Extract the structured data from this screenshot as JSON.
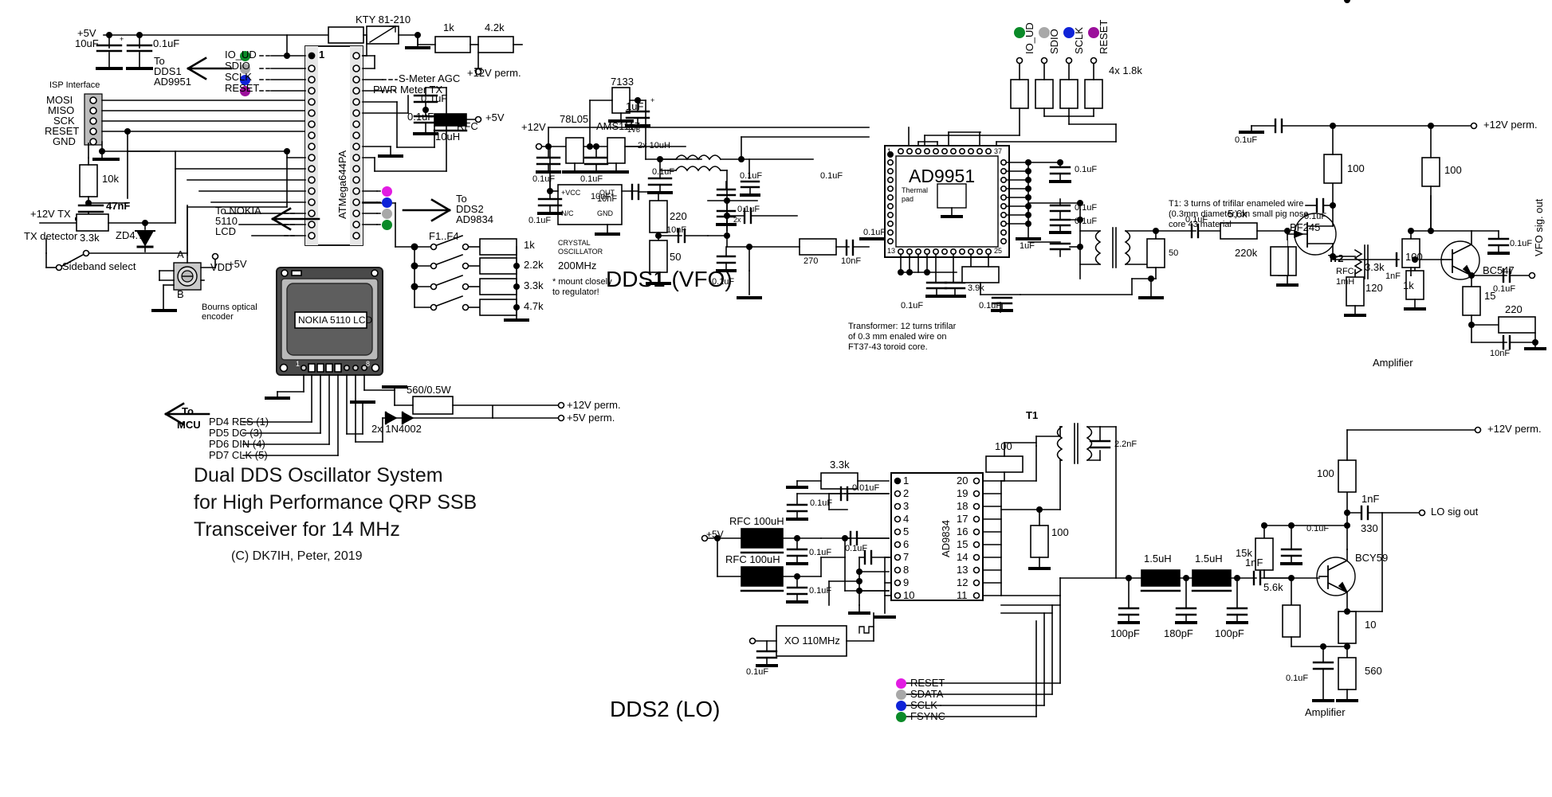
{
  "document": {
    "type": "schematic",
    "title_lines": [
      "Dual DDS Oscillator System",
      "for High Performance QRP SSB",
      "Transceiver for 14 MHz"
    ],
    "copyright": "(C) DK7IH, Peter, 2019",
    "section_dds1": "DDS1 (VFO)",
    "section_dds2": "DDS2 (LO)"
  },
  "mcu": {
    "chip": "ATMega644PA",
    "pin1": "1",
    "isp_header_title": "ISP Interface",
    "isp_pins": [
      "MOSI",
      "MISO",
      "SCK",
      "RESET",
      "GND"
    ],
    "bus_labels": [
      "IO_UD",
      "SDIO",
      "SCLK",
      "RESET"
    ],
    "bus_colors": [
      "#0a8a28",
      "#a8a8a8",
      "#0f23d8",
      "#9b0f9b"
    ],
    "to_dds1": [
      "To",
      "DDS1",
      "AD9951"
    ],
    "to_dds2": [
      "To",
      "DDS2",
      "AD9834"
    ],
    "to_lcd": [
      "To NOKIA",
      "5110",
      "LCD"
    ],
    "to_mcu": [
      "To",
      "MCU"
    ],
    "dds2_dot_colors": [
      "#e21ce2",
      "#0f23d8",
      "#a8a8a8",
      "#0a8a28"
    ],
    "signals": [
      "S-Meter AGC",
      "PWR Meter TX"
    ],
    "sensor": "KTY 81-210",
    "rails": {
      "p5v_a": "+5V",
      "p5v_b": "+5V",
      "p12v_perm": "+12V perm.",
      "p12v_tx": "+12V TX",
      "vdd": "VDD",
      "vdd_rail": "+5V"
    },
    "caps": [
      "10uF",
      "0.1uF",
      "0.1uF",
      "0.1uF",
      "47nF"
    ],
    "res": [
      "1k",
      "4.2k",
      "10k",
      "3.3k"
    ],
    "rfc": "RFC",
    "rfc_val": "10uH",
    "zener": "ZD4.7",
    "tx_detector": "TX detector",
    "sideband_select": "Sideband select",
    "encoder": {
      "a": "A",
      "b": "B",
      "name_lines": [
        "Bourns optical",
        "encoder"
      ]
    },
    "fkeys": {
      "label": "F1..F4",
      "resistors": [
        "1k",
        "2.2k",
        "3.3k",
        "4.7k"
      ]
    }
  },
  "lcd": {
    "screen_text": "NOKIA 5110 LCD",
    "pin_first": "1",
    "pin_last": "8",
    "mcu_pins": [
      "PD4 RES (1)",
      "PD5 DC (3)",
      "PD6 DIN (4)",
      "PD7 CLK (5)"
    ],
    "diodes": "2x 1N4002",
    "resistor": "560/0.5W",
    "rail_12v": "+12V perm.",
    "rail_5v": "+5V perm."
  },
  "dds1": {
    "chip": "AD9951",
    "thermal_pad": [
      "Thermal",
      "pad"
    ],
    "pin_numbers": [
      "1",
      "37",
      "13",
      "25"
    ],
    "bus_labels": [
      "IO_UD",
      "SDIO",
      "SCLK",
      "RESET"
    ],
    "bus_colors": [
      "#0a8a28",
      "#a8a8a8",
      "#0f23d8",
      "#9b0f9b"
    ],
    "bus_res": "4x 1.8k",
    "regs": [
      "78L05",
      "AMS1117",
      "7133"
    ],
    "reg_out": "1V8",
    "rail_in": "+12V",
    "chokes": "2x 10uH",
    "xo": {
      "title_lines": [
        "CRYSTAL",
        "OSCILLATOR"
      ],
      "freq": "200MHz",
      "pins": [
        "+VCC",
        "OUT",
        "N/C",
        "GND"
      ]
    },
    "note_mount": [
      "* mount closely",
      "to regulator!"
    ],
    "caps": [
      "0.1uF",
      "0.1uF",
      "0.1uF",
      "1uF",
      "10uF*",
      "10nF",
      "10nF",
      "0.1uF",
      "0.1uF",
      "0.1uF",
      "0.1uF",
      "0.1uF",
      "0.1uF",
      "0.1uF",
      "0.1uF",
      "0.1uF",
      "1uF",
      "10nF",
      "0.1uF"
    ],
    "res": [
      "220",
      "50",
      "270",
      "3.9k",
      "50"
    ],
    "t1_note": [
      "T1: 3 turns of trifilar enameled wire",
      "(0.3mm diameter) on small pig nose",
      "core 43 material"
    ]
  },
  "vfo_amp": {
    "title": "Amplifier",
    "jfet": "BF245",
    "jfet_ref": "Tr2",
    "bjt": "BC547",
    "rfc": [
      "RFC",
      "1mH"
    ],
    "res": [
      "5.6k",
      "220k",
      "120",
      "100",
      "100",
      "3.3k",
      "100",
      "1k",
      "15",
      "220"
    ],
    "caps": [
      "0.1uF",
      "0.1uF",
      "0.1uF",
      "0.1uF",
      "1nF",
      "10nF",
      "0.1uF"
    ],
    "rail": "+12V perm.",
    "out": "VFO sig. out"
  },
  "dds2": {
    "chip": "AD9834",
    "pins_left": [
      "1",
      "2",
      "3",
      "4",
      "5",
      "6",
      "7",
      "8",
      "9",
      "10"
    ],
    "pins_right": [
      "20",
      "19",
      "18",
      "17",
      "16",
      "15",
      "14",
      "13",
      "12",
      "11"
    ],
    "chokes": [
      "RFC 100uH",
      "RFC 100uH"
    ],
    "caps": [
      "0.1uF",
      "0.1uF",
      "0.1uF",
      "0.01uF",
      "0.1uF",
      "0.1uF",
      "2.2nF",
      "1nF",
      "100pF",
      "180pF",
      "100pF"
    ],
    "res": [
      "3.3k",
      "100",
      "100"
    ],
    "inds": [
      "1.5uH",
      "1.5uH"
    ],
    "rail_5v": "+5V",
    "xo_label": "XO 110MHz",
    "xo_cap": "0.1uF",
    "transformer": "T1",
    "t1_note": [
      "Transformer: 12 turns trifilar",
      "of 0.3 mm enaled wire on",
      "FT37-43 toroid core."
    ],
    "bus": [
      {
        "label": "RESET",
        "color": "#e21ce2"
      },
      {
        "label": "SDATA",
        "color": "#a8a8a8"
      },
      {
        "label": "SCLK",
        "color": "#0f23d8"
      },
      {
        "label": "FSYNC",
        "color": "#0a8a28"
      }
    ]
  },
  "lo_amp": {
    "title": "Amplifier",
    "bjt": "BCY59",
    "res": [
      "15k",
      "100",
      "330",
      "5.6k",
      "10",
      "560"
    ],
    "caps": [
      "0.1uF",
      "1nF",
      "0.1uF"
    ],
    "rail": "+12V perm.",
    "out": "LO sig out"
  }
}
